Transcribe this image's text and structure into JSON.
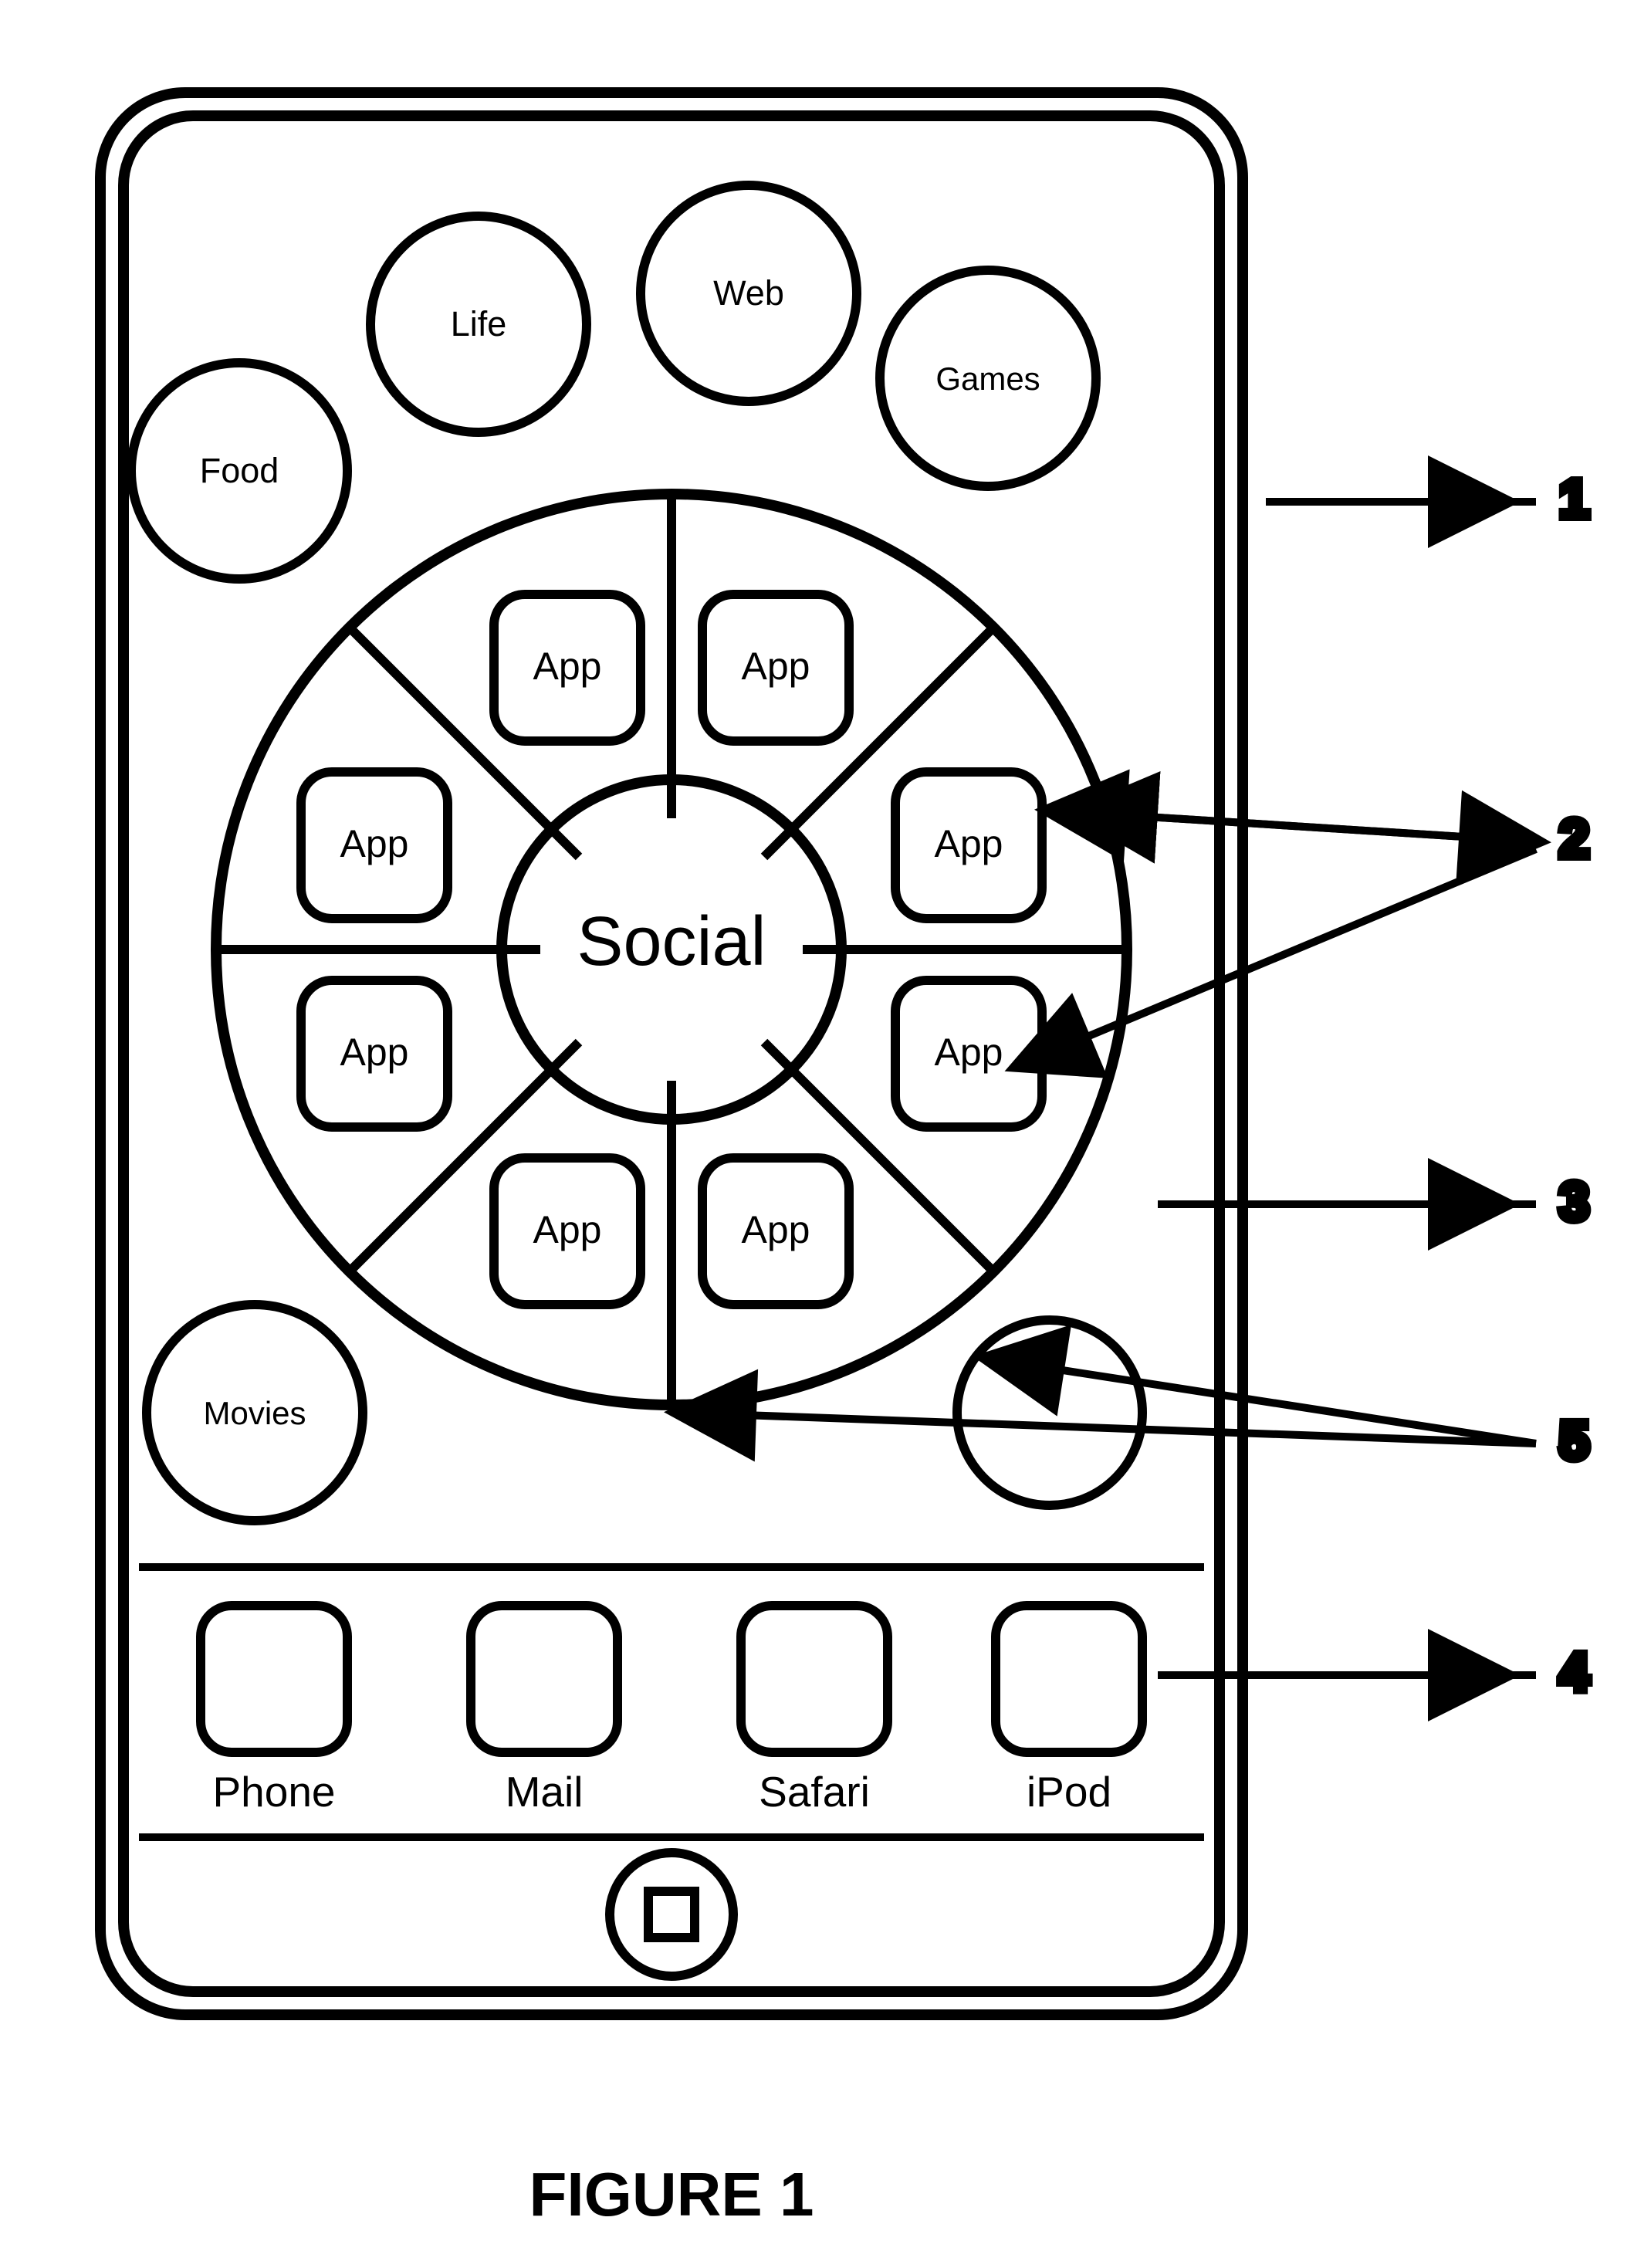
{
  "figure_caption": "FIGURE 1",
  "center_label": "Social",
  "wheel_apps": [
    "App",
    "App",
    "App",
    "App",
    "App",
    "App",
    "App",
    "App"
  ],
  "outer_categories": {
    "food": "Food",
    "life": "Life",
    "web": "Web",
    "games": "Games",
    "movies": "Movies",
    "blank": ""
  },
  "dock": [
    "Phone",
    "Mail",
    "Safari",
    "iPod"
  ],
  "callouts": {
    "c1": "1",
    "c2": "2",
    "c3": "3",
    "c4": "4",
    "c5": "5"
  }
}
